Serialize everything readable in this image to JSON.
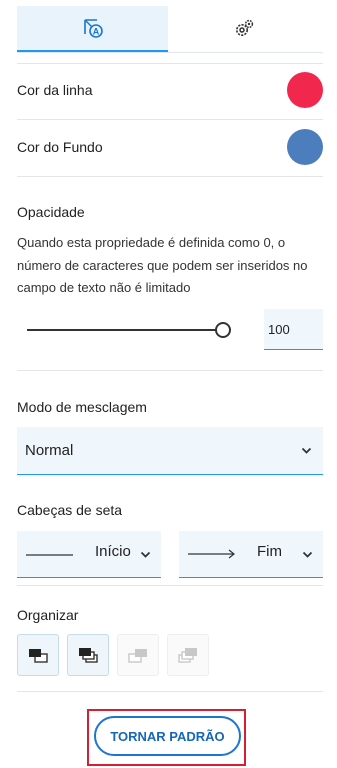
{
  "tabs": [
    {
      "icon": "style-icon",
      "active": true
    },
    {
      "icon": "gears-icon",
      "active": false
    }
  ],
  "line_color": {
    "label": "Cor da linha",
    "color": "#f2274d"
  },
  "fill_color": {
    "label": "Cor do Fundo",
    "color": "#4c7ebd"
  },
  "opacity": {
    "title": "Opacidade",
    "description": "Quando esta propriedade é definida como 0, o número de caracteres que podem ser inseridos no campo de texto não é limitado",
    "value": "100",
    "slider_fraction": 1.0
  },
  "blend": {
    "title": "Modo de mesclagem",
    "value": "Normal"
  },
  "arrowheads": {
    "title": "Cabeças de seta",
    "start_value": "Início",
    "end_value": "Fim"
  },
  "arrange": {
    "title": "Organizar",
    "buttons": [
      {
        "icon": "bring-forward-icon",
        "enabled": true
      },
      {
        "icon": "bring-to-front-icon",
        "enabled": true
      },
      {
        "icon": "send-backward-icon",
        "enabled": false
      },
      {
        "icon": "send-to-back-icon",
        "enabled": false
      }
    ]
  },
  "default_button": {
    "label": "TORNAR PADRÃO"
  },
  "colors": {
    "accent": "#2196f3",
    "highlight": "#d42030"
  }
}
